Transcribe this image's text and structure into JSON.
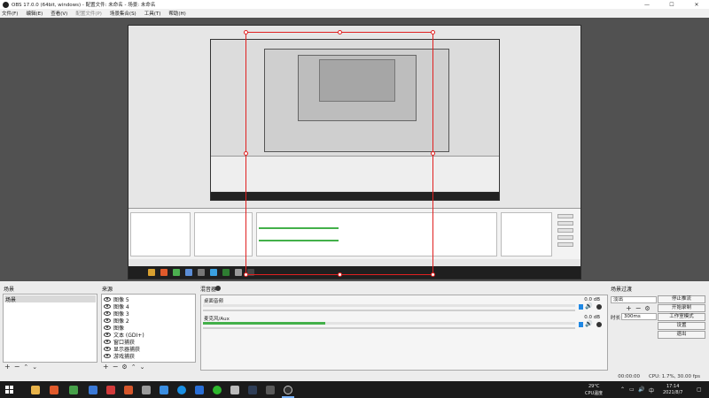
{
  "window": {
    "title": "OBS 17.0.0 (64bit, windows) - 配置文件: 未命名 - 场景: 未命名",
    "minimize": "—",
    "maximize": "☐",
    "close": "✕"
  },
  "menu": [
    "文件(F)",
    "编辑(E)",
    "查看(V)",
    "配置文件(P)",
    "场景集合(S)",
    "工具(T)",
    "帮助(H)"
  ],
  "docks": {
    "scenes": {
      "title": "场景",
      "items": [
        "场景"
      ]
    },
    "sources": {
      "title": "来源",
      "items": [
        "图像 5",
        "图像 4",
        "图像 3",
        "图像 2",
        "图像",
        "文本 (GDI+)",
        "窗口捕获",
        "显示器捕获",
        "游戏捕获"
      ]
    },
    "mixer": {
      "title": "混音器",
      "channels": [
        {
          "label": "桌面音频",
          "db": "0.0 dB",
          "level": 0
        },
        {
          "label": "麦克风/Aux",
          "db": "0.0 dB",
          "level": 0.3
        }
      ]
    },
    "transitions": {
      "title": "场景过渡",
      "selected": "淡出",
      "duration_label": "时长",
      "duration_value": "300ms"
    },
    "controls": [
      "停止推流",
      "开始录制",
      "工作室模式",
      "设置",
      "退出"
    ]
  },
  "status": {
    "time": "00:00:00",
    "cpu": "CPU: 1.7%, 30.00 fps"
  },
  "taskbar": {
    "weather": "29°C",
    "weather_sub": "CPU温度",
    "lang": "中",
    "clock_time": "17:14",
    "clock_date": "2021/8/7"
  },
  "colors": {
    "selection": "#e02020",
    "meter": "#43b04a",
    "accent": "#1e88e5"
  }
}
